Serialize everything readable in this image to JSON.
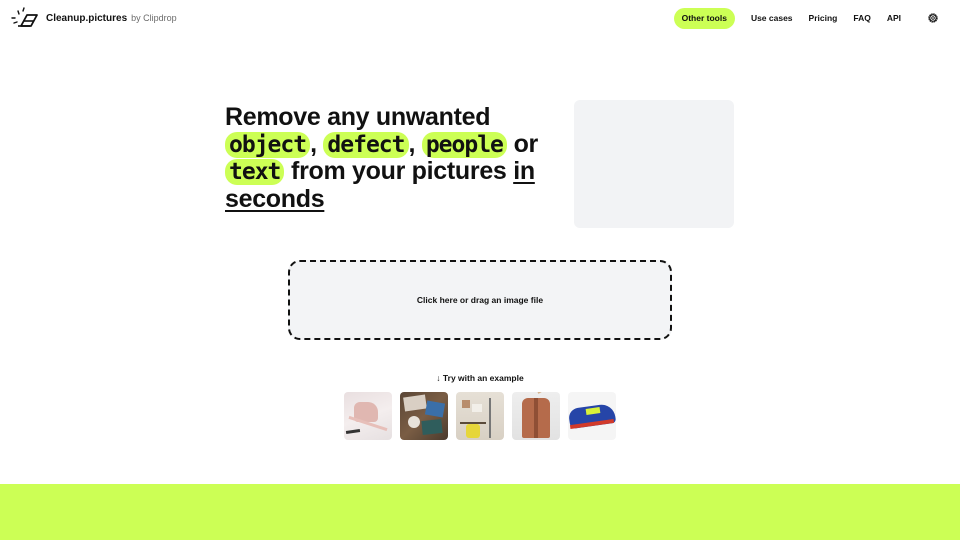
{
  "header": {
    "brand": "Cleanup.pictures",
    "by": "by Clipdrop",
    "nav": {
      "other_tools": "Other tools",
      "use_cases": "Use cases",
      "pricing": "Pricing",
      "faq": "FAQ",
      "api": "API"
    },
    "icons": {
      "logo": "eraser-icon",
      "settings": "gear-icon"
    }
  },
  "hero": {
    "line1": "Remove any unwanted",
    "tag1": "object",
    "sep1": ",",
    "tag2": "defect",
    "sep2": ",",
    "tag3": "people",
    "or": "or",
    "tag4": "text",
    "rest": "from your pictures",
    "underline1": "in",
    "underline2": "seconds"
  },
  "dropzone": {
    "label": "Click here or drag an image file"
  },
  "examples": {
    "title": "↓ Try with an example",
    "items": [
      {
        "name": "pink handbag"
      },
      {
        "name": "desk with magazines"
      },
      {
        "name": "room with yellow chair"
      },
      {
        "name": "brown jacket"
      },
      {
        "name": "blue sneaker"
      }
    ]
  },
  "colors": {
    "accent": "#ccff55",
    "text": "#111111",
    "panel": "#f3f4f6"
  }
}
